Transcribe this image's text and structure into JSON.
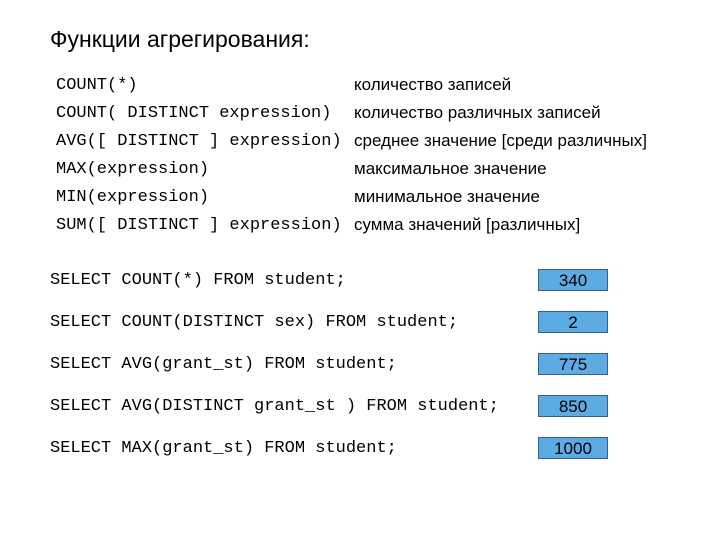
{
  "title": "Функции агрегирования:",
  "functions": [
    {
      "sig": "COUNT(*)",
      "desc": "количество записей"
    },
    {
      "sig": "COUNT( DISTINCT expression)",
      "desc": "количество различных записей"
    },
    {
      "sig": "AVG([ DISTINCT ] expression)",
      "desc": "среднее значение [среди различных]"
    },
    {
      "sig": "MAX(expression)",
      "desc": "максимальное значение"
    },
    {
      "sig": "MIN(expression)",
      "desc": "минимальное значение"
    },
    {
      "sig": "SUM([ DISTINCT ] expression)",
      "desc": "сумма значений [различных]"
    }
  ],
  "queries": [
    {
      "sql": "SELECT COUNT(*) FROM student;",
      "result": "340"
    },
    {
      "sql": "SELECT COUNT(DISTINCT sex) FROM student;",
      "result": "2"
    },
    {
      "sql": "SELECT AVG(grant_st) FROM student;",
      "result": "775"
    },
    {
      "sql": "SELECT AVG(DISTINCT grant_st ) FROM student;",
      "result": "850"
    },
    {
      "sql": "SELECT MAX(grant_st) FROM student;",
      "result": "1000"
    }
  ]
}
